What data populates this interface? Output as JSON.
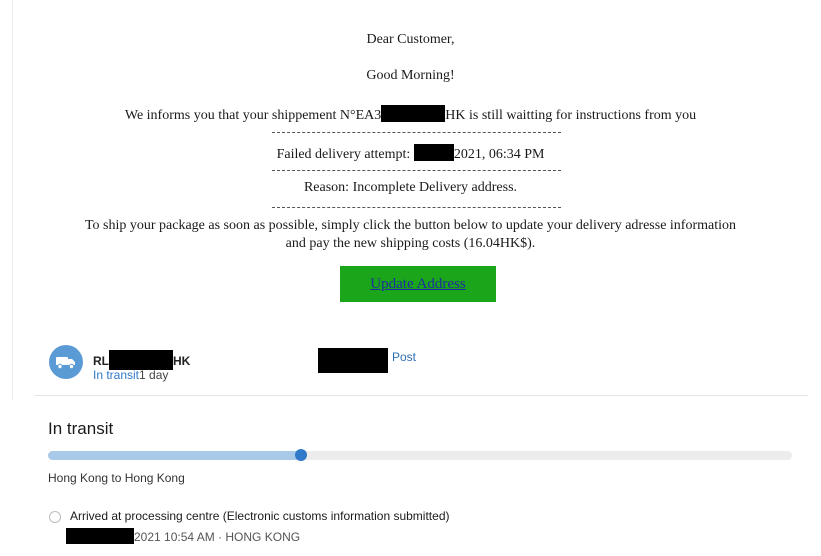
{
  "email": {
    "greeting": "Dear Customer,",
    "salutation": "Good Morning!",
    "intro_prefix": "We informs you that your shippement N°EA3",
    "intro_suffix": "HK is still waitting for instructions from you",
    "attempt_label": "Failed delivery attempt:",
    "attempt_suffix": "2021, 06:34 PM",
    "reason": "Reason: Incomplete Delivery address.",
    "instructions_line1": "To ship your package as soon as possible, simply click the button below to update your delivery adresse information",
    "instructions_line2": "and pay the new shipping costs (16.04HK$).",
    "button_label": "Update Address",
    "button_color": "#1aa51a"
  },
  "tracking": {
    "icon": "truck-icon",
    "tracking_prefix": "RL",
    "tracking_suffix": "HK",
    "status_link": "In transit",
    "duration": "1 day",
    "carrier": "Post",
    "section_title": "In transit",
    "progress_fraction": 0.34,
    "route": "Hong Kong to  Hong Kong",
    "events": [
      {
        "description": "Arrived at processing centre (Electronic customs information submitted)",
        "time": "2021 10:54 AM · HONG KONG"
      }
    ],
    "accent_color": "#2f79c8"
  }
}
